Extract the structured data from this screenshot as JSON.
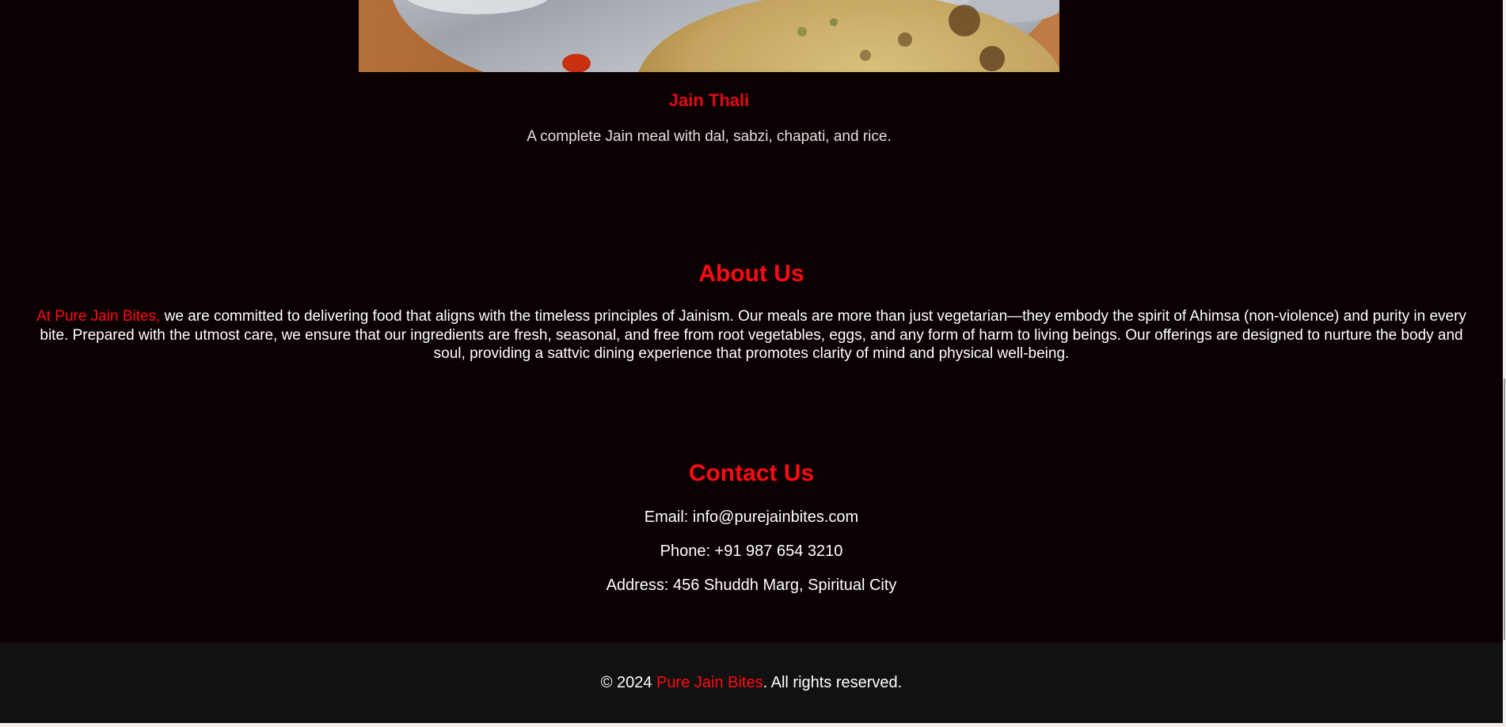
{
  "menu_item": {
    "title": "Jain Thali",
    "description": "A complete Jain meal with dal, sabzi, chapati, and rice."
  },
  "about": {
    "title": "About Us",
    "brand_lead": "At Pure Jain Bites,",
    "body": " we are committed to delivering food that aligns with the timeless principles of Jainism. Our meals are more than just vegetarian—they embody the spirit of Ahimsa (non-violence) and purity in every bite. Prepared with the utmost care, we ensure that our ingredients are fresh, seasonal, and free from root vegetables, eggs, and any form of harm to living beings. Our offerings are designed to nurture the body and soul, providing a sattvic dining experience that promotes clarity of mind and physical well-being."
  },
  "contact": {
    "title": "Contact Us",
    "email": "Email: info@purejainbites.com",
    "phone": "Phone: +91 987 654 3210",
    "address": "Address: 456 Shuddh Marg, Spiritual City"
  },
  "footer": {
    "prefix": "© 2024 ",
    "brand": "Pure Jain Bites",
    "suffix": ". All rights reserved."
  },
  "colors": {
    "background": "#0b0002",
    "accent": "#ff0a12",
    "footer_bg": "#111111",
    "text": "#ffffff"
  }
}
